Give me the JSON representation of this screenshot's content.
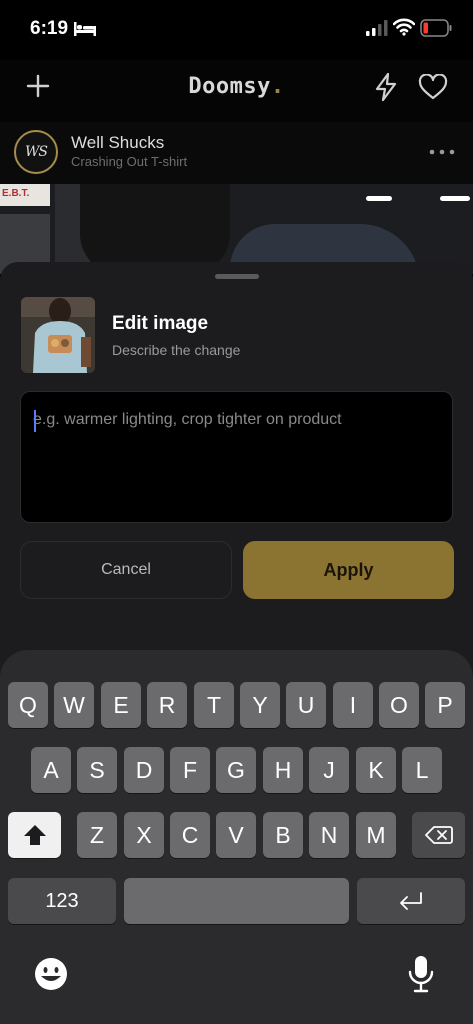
{
  "status_bar": {
    "time": "6:19"
  },
  "header": {
    "title": "Doomsy",
    "title_dot": "."
  },
  "post": {
    "avatar_text": "WS",
    "username": "Well Shucks",
    "subtitle": "Crashing Out T-shirt"
  },
  "photo_sign": "E.B.T.",
  "sheet": {
    "title": "Edit image",
    "subtitle": "Describe the change",
    "prompt_placeholder": "e.g. warmer lighting, crop tighter on product",
    "prompt_value": "",
    "cancel_label": "Cancel",
    "apply_label": "Apply"
  },
  "keyboard": {
    "row1": [
      "Q",
      "W",
      "E",
      "R",
      "T",
      "Y",
      "U",
      "I",
      "O",
      "P"
    ],
    "row2": [
      "A",
      "S",
      "D",
      "F",
      "G",
      "H",
      "J",
      "K",
      "L"
    ],
    "row3": [
      "Z",
      "X",
      "C",
      "V",
      "B",
      "N",
      "M"
    ],
    "numbers_label": "123"
  },
  "colors": {
    "accent": "#8b7332",
    "sheet_background": "#1c1c1e",
    "keyboard_background": "#2b2b2d",
    "battery_low": "#ff3b30"
  },
  "icons": [
    "bed-icon",
    "signal-icon",
    "wifi-icon",
    "battery-icon",
    "plus-icon",
    "bolt-icon",
    "heart-icon",
    "more-icon",
    "shift-icon",
    "delete-icon",
    "return-icon",
    "emoji-icon",
    "mic-icon"
  ]
}
